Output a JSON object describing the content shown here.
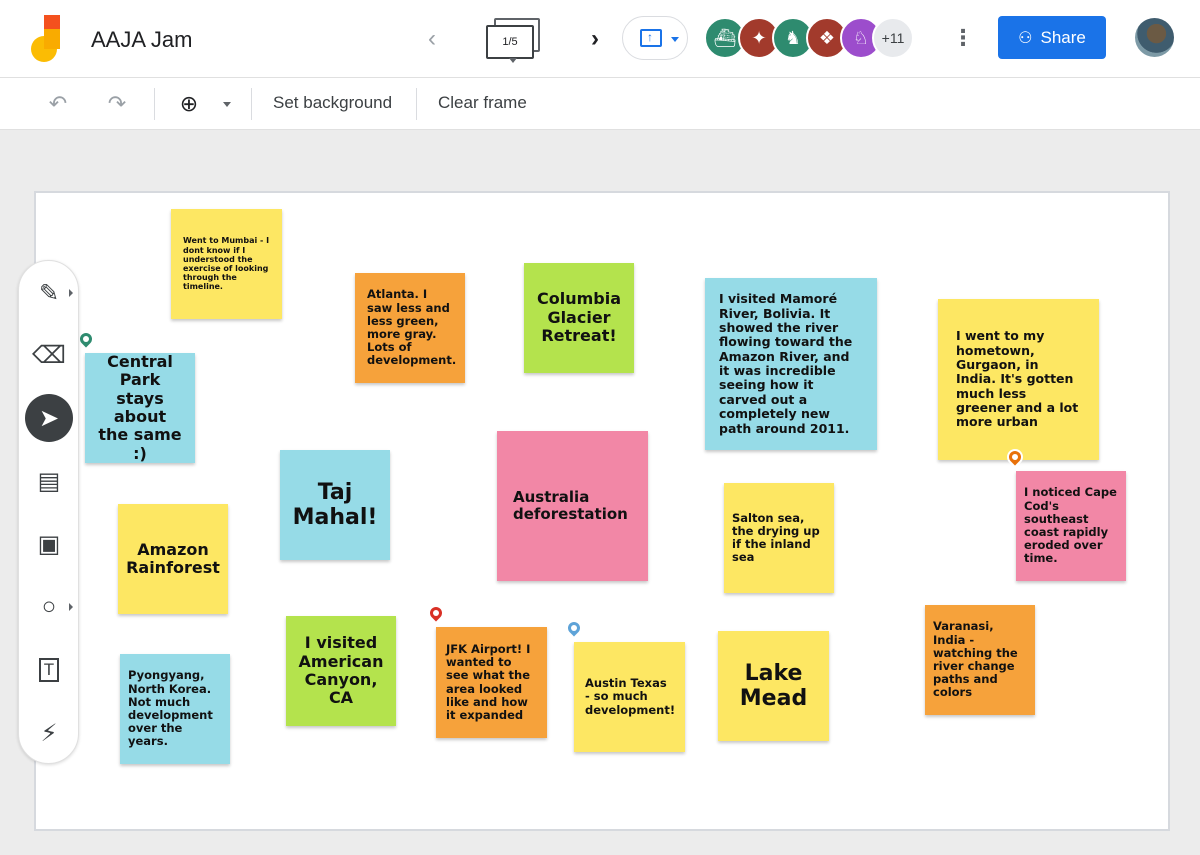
{
  "header": {
    "app_title": "AAJA Jam",
    "frame_indicator": "1/5",
    "collaborators_more": "+11",
    "share_label": "Share"
  },
  "toolbar": {
    "set_background": "Set background",
    "clear_frame": "Clear frame"
  },
  "icons": {
    "undo": "↶",
    "redo": "↷",
    "zoom": "⊕",
    "prev": "‹",
    "next": "›",
    "more": "⋮",
    "pen": "✎",
    "eraser": "⌫",
    "select": "➤",
    "sticky": "▤",
    "image": "▣",
    "circle": "○",
    "text": "T",
    "laser": "⚡"
  },
  "colors": {
    "accent": "#1a73e8",
    "yellow": "#fde763",
    "orange": "#f6a23b",
    "green": "#b4e34d",
    "blue": "#96dbe7",
    "pink": "#f287a6"
  },
  "notes": {
    "mumbai": "Went to Mumbai - I dont know if I understood the exercise of looking through the timeline.",
    "atlanta": "Atlanta. I saw less and less green, more gray. Lots of development.",
    "columbia": "Columbia Glacier Retreat!",
    "mamore": "I visited Mamoré River, Bolivia. It showed the river flowing toward the Amazon River, and it was incredible seeing how it carved out a completely new path around 2011.",
    "gurgaon": "I went to my hometown, Gurgaon, in India. It's gotten much less greener and a lot more urban",
    "central_park": "Central Park stays about the same :)",
    "taj": "Taj Mahal!",
    "australia": "Australia deforestation",
    "salton": "Salton sea, the drying up if the inland sea",
    "cape_cod": "I noticed Cape Cod's southeast coast rapidly eroded over time.",
    "amazon": "Amazon Rainforest",
    "american_canyon": "I visited American Canyon, CA",
    "jfk": "JFK Airport! I wanted to see what the area looked like and how it expanded",
    "austin": "Austin Texas - so much development!",
    "lake_mead": "Lake Mead",
    "varanasi": "Varanasi, India - watching the river change paths and colors",
    "pyongyang": "Pyongyang, North Korea. Not much development over the years."
  }
}
